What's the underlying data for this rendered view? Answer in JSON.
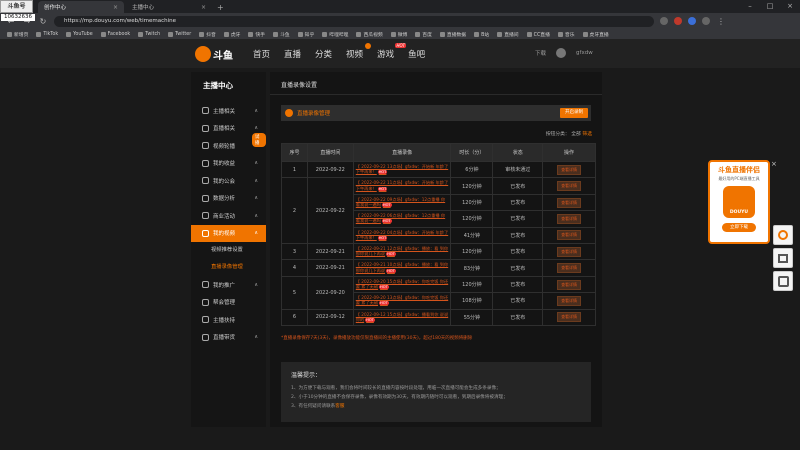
{
  "browser": {
    "tabs": [
      {
        "label": "创作中心",
        "active": true
      },
      {
        "label": "主播中心",
        "active": false
      }
    ],
    "url": "https://mp.douyu.com/web/timemachine",
    "bookmarks": [
      "新增页",
      "TikTok",
      "YouTube",
      "Facebook",
      "Twitch",
      "Twitter",
      "抖音",
      "虎牙",
      "快手",
      "斗鱼",
      "知乎",
      "哔哩哔哩",
      "西瓜视频",
      "微博",
      "百度",
      "直播数据",
      "B站",
      "直播间",
      "CC直播",
      "音乐",
      "虎牙直播"
    ]
  },
  "overlay": {
    "logo": "斗鱼号",
    "id": "10632636"
  },
  "header": {
    "logo": "斗鱼",
    "nav": [
      "首页",
      "直播",
      "分类",
      "视频",
      "游戏",
      "鱼吧"
    ],
    "right": [
      "下载",
      "gfxdw"
    ]
  },
  "sidebar": {
    "title": "主播中心",
    "items": [
      {
        "label": "主播相关"
      },
      {
        "label": "直播相关"
      },
      {
        "label": "视频轮播"
      },
      {
        "label": "我的收益"
      },
      {
        "label": "我的公会"
      },
      {
        "label": "数据分析"
      },
      {
        "label": "商业活动"
      },
      {
        "label": "我的视频"
      },
      {
        "label": "我的推广"
      },
      {
        "label": "帮会管理"
      },
      {
        "label": "主播扶持"
      },
      {
        "label": "直播带货"
      }
    ],
    "subs": [
      "视频推荐设置",
      "直播录像管理"
    ],
    "new_tag": "试播"
  },
  "main": {
    "title": "直播录像设置",
    "manage_label": "直播录像管理",
    "manage_btn": "开启录制",
    "filter_text": "按钮分类：",
    "filter_option": "全部",
    "filter_link": "筛选",
    "table": {
      "headers": [
        "序号",
        "直播时间",
        "直播录像",
        "时长（分）",
        "状态",
        "操作"
      ],
      "groups": [
        {
          "no": "1",
          "date": "2022-09-22",
          "rows": [
            {
              "title": "【 2022-09-22 13点场】gfxdw：开始新 年龄了 下午再来！",
              "dur": "6分钟",
              "status": "审核未通过"
            }
          ]
        },
        {
          "no": "2",
          "date": "2022-09-22",
          "rows": [
            {
              "title": "【 2022-09-22 11点场】gfxdw：开始新 年龄了 下午再来！",
              "dur": "120分钟",
              "status": "已发布"
            },
            {
              "title": "【 2022-09-22 09点场】gfxdw：12点重播 你看我说一遍吗",
              "dur": "120分钟",
              "status": "已发布"
            },
            {
              "title": "【 2022-09-22 06点场】gfxdw：12点重播 你看我说一遍吗",
              "dur": "120分钟",
              "status": "已发布"
            },
            {
              "title": "【 2022-09-22 04点场】gfxdw：开始新 年龄了 下午再来！",
              "dur": "41分钟",
              "status": "已发布"
            }
          ]
        },
        {
          "no": "3",
          "date": "2022-09-21",
          "rows": [
            {
              "title": "【 2022-09-21 12点场】gfxdw：播放：看 到你那你说几下再说",
              "dur": "120分钟",
              "status": "已发布"
            }
          ]
        },
        {
          "no": "4",
          "date": "2022-09-21",
          "rows": [
            {
              "title": "【 2022-09-21 10点场】gfxdw：播放：看 到你那你说几下再说",
              "dur": "83分钟",
              "status": "已发布"
            }
          ]
        },
        {
          "no": "5",
          "date": "2022-09-20",
          "rows": [
            {
              "title": "【 2022-09-20 15点场】gfxdw：你吃完饭 你还要 累了无敌",
              "dur": "120分钟",
              "status": "已发布"
            },
            {
              "title": "【 2022-09-20 13点场】gfxdw：你吃完饭 你还要 累了无敌",
              "dur": "108分钟",
              "status": "已发布"
            }
          ]
        },
        {
          "no": "6",
          "date": "2022-09-12",
          "rows": [
            {
              "title": "【 2022-09-12 15点场】gfxdw：播看到你 说说你的",
              "dur": "55分钟",
              "status": "已发布"
            }
          ]
        }
      ],
      "hot_badge": "HOT",
      "op_label": "查看详情"
    },
    "red_notice": "*直播录像保存7天(3天)，录像播放功能仅限直播间的主播使用(30天)，超过180天的视频将删除",
    "tips": {
      "title": "温馨提示：",
      "lines": [
        "1、为方便下载与观看，我们会将时间较长的直播内容按时段处理，用临一次直播可能会生成多条录像；",
        "2、小于10分钟的直播不会保存录像，录像有效期为30天，有效期内随时可以观看，到期后录像将被清理；",
        "3、有任何疑问请联系"
      ],
      "link": "客服"
    }
  },
  "ad": {
    "title": "斗鱼直播伴侣",
    "subtitle": "最好用的PC端直播工具",
    "app_name": "DOUYU",
    "download": "立即下载"
  }
}
